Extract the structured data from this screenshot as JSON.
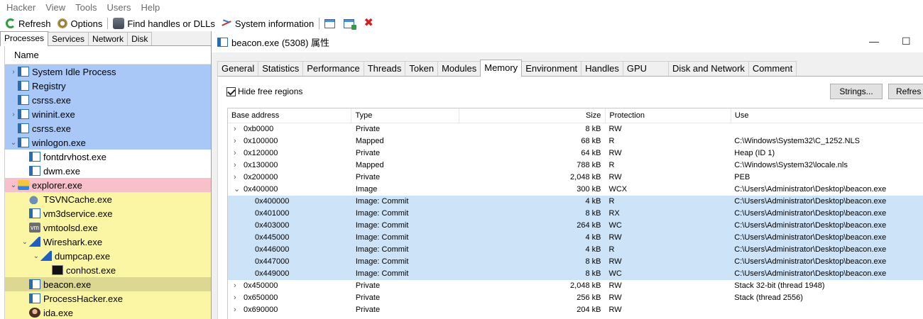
{
  "menu": [
    "Hacker",
    "View",
    "Tools",
    "Users",
    "Help"
  ],
  "toolbar": {
    "refresh": "Refresh",
    "options": "Options",
    "find_handles": "Find handles or DLLs",
    "system_info": "System information"
  },
  "left_tabs": [
    "Processes",
    "Services",
    "Network",
    "Disk"
  ],
  "process_column": "Name",
  "processes": [
    {
      "name": "System Idle Process",
      "expander": "›",
      "icon": "app-icon",
      "bg": "blue",
      "indent": 0
    },
    {
      "name": "Registry",
      "expander": "",
      "icon": "app-icon",
      "bg": "blue",
      "indent": 0
    },
    {
      "name": "csrss.exe",
      "expander": "",
      "icon": "app-icon",
      "bg": "blue",
      "indent": 0
    },
    {
      "name": "wininit.exe",
      "expander": "›",
      "icon": "app-icon",
      "bg": "blue",
      "indent": 0
    },
    {
      "name": "csrss.exe",
      "expander": "",
      "icon": "app-icon",
      "bg": "blue",
      "indent": 0
    },
    {
      "name": "winlogon.exe",
      "expander": "⌄",
      "icon": "app-icon",
      "bg": "blue",
      "indent": 0
    },
    {
      "name": "fontdrvhost.exe",
      "expander": "",
      "icon": "app-icon",
      "bg": "white",
      "indent": 1
    },
    {
      "name": "dwm.exe",
      "expander": "",
      "icon": "app-icon",
      "bg": "white",
      "indent": 1
    },
    {
      "name": "explorer.exe",
      "expander": "⌄",
      "icon": "explorer-icon",
      "bg": "pink",
      "indent": 0
    },
    {
      "name": "TSVNCache.exe",
      "expander": "",
      "icon": "tortoise-icon",
      "bg": "yellow",
      "indent": 1
    },
    {
      "name": "vm3dservice.exe",
      "expander": "",
      "icon": "app-icon",
      "bg": "yellow",
      "indent": 1
    },
    {
      "name": "vmtoolsd.exe",
      "expander": "",
      "icon": "vm-icon",
      "bg": "yellow",
      "indent": 1
    },
    {
      "name": "Wireshark.exe",
      "expander": "⌄",
      "icon": "wireshark-icon",
      "bg": "yellow",
      "indent": 1
    },
    {
      "name": "dumpcap.exe",
      "expander": "⌄",
      "icon": "wireshark-icon",
      "bg": "yellow",
      "indent": 2
    },
    {
      "name": "conhost.exe",
      "expander": "",
      "icon": "console-icon",
      "bg": "yellow",
      "indent": 3
    },
    {
      "name": "beacon.exe",
      "expander": "",
      "icon": "app-icon",
      "bg": "sel",
      "indent": 1
    },
    {
      "name": "ProcessHacker.exe",
      "expander": "",
      "icon": "app-icon",
      "bg": "yellow",
      "indent": 1
    },
    {
      "name": "ida.exe",
      "expander": "",
      "icon": "ida-icon",
      "bg": "yellow",
      "indent": 1
    }
  ],
  "dialog": {
    "title": "beacon.exe (5308) 属性",
    "minimize": "—",
    "maximize": "☐",
    "tabs": [
      "General",
      "Statistics",
      "Performance",
      "Threads",
      "Token",
      "Modules",
      "Memory",
      "Environment",
      "Handles",
      "GPU",
      "Disk and Network",
      "Comment"
    ],
    "active_tab": "Memory",
    "hide_free_label": "Hide free regions",
    "hide_free_checked": true,
    "strings_button": "Strings...",
    "refresh_button": "Refres"
  },
  "memory": {
    "columns": [
      "Base address",
      "Type",
      "Size",
      "Protection",
      "Use"
    ],
    "rows": [
      {
        "addr": "0xb0000",
        "type": "Private",
        "size": "8 kB",
        "prot": "RW",
        "use": "",
        "arrow": "›",
        "child": false
      },
      {
        "addr": "0x100000",
        "type": "Mapped",
        "size": "68 kB",
        "prot": "R",
        "use": "C:\\Windows\\System32\\C_1252.NLS",
        "arrow": "›",
        "child": false
      },
      {
        "addr": "0x120000",
        "type": "Private",
        "size": "64 kB",
        "prot": "RW",
        "use": "Heap (ID 1)",
        "arrow": "›",
        "child": false
      },
      {
        "addr": "0x130000",
        "type": "Mapped",
        "size": "788 kB",
        "prot": "R",
        "use": "C:\\Windows\\System32\\locale.nls",
        "arrow": "›",
        "child": false
      },
      {
        "addr": "0x200000",
        "type": "Private",
        "size": "2,048 kB",
        "prot": "RW",
        "use": "PEB",
        "arrow": "›",
        "child": false
      },
      {
        "addr": "0x400000",
        "type": "Image",
        "size": "300 kB",
        "prot": "WCX",
        "use": "C:\\Users\\Administrator\\Desktop\\beacon.exe",
        "arrow": "⌄",
        "child": false
      },
      {
        "addr": "0x400000",
        "type": "Image: Commit",
        "size": "4 kB",
        "prot": "R",
        "use": "C:\\Users\\Administrator\\Desktop\\beacon.exe",
        "arrow": "",
        "child": true
      },
      {
        "addr": "0x401000",
        "type": "Image: Commit",
        "size": "8 kB",
        "prot": "RX",
        "use": "C:\\Users\\Administrator\\Desktop\\beacon.exe",
        "arrow": "",
        "child": true
      },
      {
        "addr": "0x403000",
        "type": "Image: Commit",
        "size": "264 kB",
        "prot": "WC",
        "use": "C:\\Users\\Administrator\\Desktop\\beacon.exe",
        "arrow": "",
        "child": true
      },
      {
        "addr": "0x445000",
        "type": "Image: Commit",
        "size": "4 kB",
        "prot": "RW",
        "use": "C:\\Users\\Administrator\\Desktop\\beacon.exe",
        "arrow": "",
        "child": true
      },
      {
        "addr": "0x446000",
        "type": "Image: Commit",
        "size": "4 kB",
        "prot": "R",
        "use": "C:\\Users\\Administrator\\Desktop\\beacon.exe",
        "arrow": "",
        "child": true
      },
      {
        "addr": "0x447000",
        "type": "Image: Commit",
        "size": "8 kB",
        "prot": "RW",
        "use": "C:\\Users\\Administrator\\Desktop\\beacon.exe",
        "arrow": "",
        "child": true
      },
      {
        "addr": "0x449000",
        "type": "Image: Commit",
        "size": "8 kB",
        "prot": "WC",
        "use": "C:\\Users\\Administrator\\Desktop\\beacon.exe",
        "arrow": "",
        "child": true
      },
      {
        "addr": "0x450000",
        "type": "Private",
        "size": "2,048 kB",
        "prot": "RW",
        "use": "Stack 32-bit (thread 1948)",
        "arrow": "›",
        "child": false
      },
      {
        "addr": "0x650000",
        "type": "Private",
        "size": "256 kB",
        "prot": "RW",
        "use": "Stack (thread 2556)",
        "arrow": "›",
        "child": false
      },
      {
        "addr": "0x690000",
        "type": "Private",
        "size": "204 kB",
        "prot": "RW",
        "use": "",
        "arrow": "›",
        "child": false
      }
    ]
  },
  "colors": {
    "system_process": "#a9c8f7",
    "explorer": "#f7c0cb",
    "user_process": "#fbf6a4",
    "selected_process": "#dcd791",
    "memory_child_row": "#cce3f8",
    "close": "#d21f1f"
  }
}
